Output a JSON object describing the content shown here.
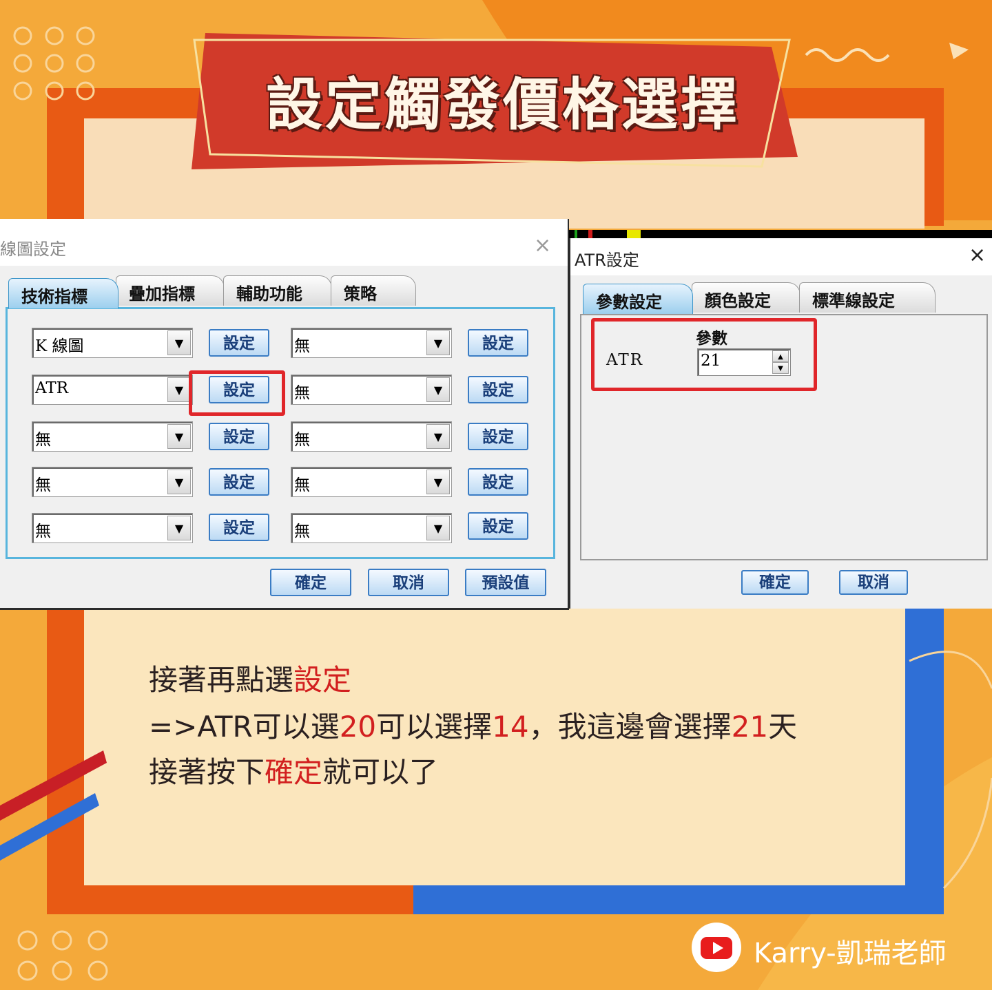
{
  "title": "設定觸發價格選擇",
  "chart_window": {
    "title": "線圖設定",
    "close_icon": "×",
    "tabs": [
      "技術指標",
      "疊加指標",
      "輔助功能",
      "策略"
    ],
    "left_combos": [
      "K 線圖",
      "ATR",
      "無",
      "無",
      "無"
    ],
    "right_combos": [
      "無",
      "無",
      "無",
      "無",
      "無"
    ],
    "set_label": "設定",
    "dropdown_arrow": "▼",
    "buttons": {
      "ok": "確定",
      "cancel": "取消",
      "default": "預設值"
    }
  },
  "atr_window": {
    "title": "ATR設定",
    "close_icon": "×",
    "tabs": [
      "參數設定",
      "顏色設定",
      "標準線設定"
    ],
    "param_header": "參數",
    "param_label": "ATR",
    "param_value": "21",
    "spin_up": "▲",
    "spin_down": "▼",
    "buttons": {
      "ok": "確定",
      "cancel": "取消"
    }
  },
  "instructions": {
    "line1_a": "接著再點選",
    "line1_b": "設定",
    "line2_a": "=>ATR可以選",
    "line2_b": "20",
    "line2_c": "可以選擇",
    "line2_d": "14",
    "line2_e": "，我這邊會選擇",
    "line2_f": "21",
    "line2_g": "天",
    "line3_a": "接著按下",
    "line3_b": "確定",
    "line3_c": "就可以了"
  },
  "brand": {
    "channel": "Karry-凱瑞老師",
    "icon": "youtube-icon"
  },
  "colors": {
    "highlight": "#d21f1f",
    "accent_blue": "#2f6fd6",
    "banner_red": "#d13a2a"
  }
}
